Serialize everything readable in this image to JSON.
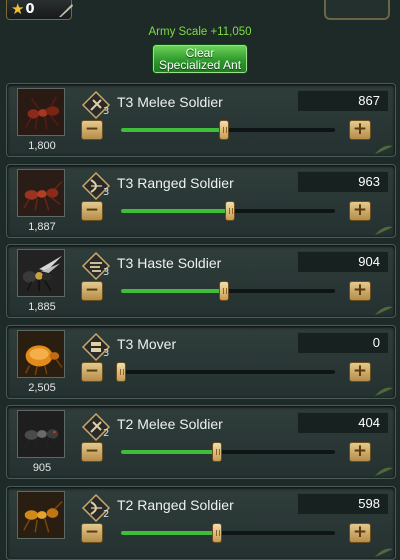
{
  "top": {
    "star_count": "0"
  },
  "army_scale": "Army Scale +11,050",
  "clear_button": "Clear Specialized Ant",
  "colors": {
    "accent_green": "#3fbf39",
    "text_green": "#7edc42",
    "button_gold": "#d9b774"
  },
  "units": [
    {
      "name": "T3 Melee Soldier",
      "tier": "3",
      "count": "1,800",
      "value": "867",
      "slider_fraction": 0.48,
      "icon": "melee-tier-icon",
      "portrait": "red-melee-ant"
    },
    {
      "name": "T3 Ranged Soldier",
      "tier": "3",
      "count": "1,887",
      "value": "963",
      "slider_fraction": 0.51,
      "icon": "ranged-tier-icon",
      "portrait": "red-ranged-ant"
    },
    {
      "name": "T3 Haste Soldier",
      "tier": "3",
      "count": "1,885",
      "value": "904",
      "slider_fraction": 0.48,
      "icon": "haste-tier-icon",
      "portrait": "flying-haste-ant"
    },
    {
      "name": "T3 Mover",
      "tier": "3",
      "count": "2,505",
      "value": "0",
      "slider_fraction": 0.0,
      "icon": "mover-tier-icon",
      "portrait": "orange-mover-ant"
    },
    {
      "name": "T2 Melee Soldier",
      "tier": "2",
      "count": "905",
      "value": "404",
      "slider_fraction": 0.45,
      "icon": "melee-tier-icon",
      "portrait": "dark-melee-ant"
    },
    {
      "name": "T2 Ranged Soldier",
      "tier": "2",
      "count": "",
      "value": "598",
      "slider_fraction": 0.45,
      "icon": "ranged-tier-icon",
      "portrait": "orange-ranged-ant"
    }
  ]
}
